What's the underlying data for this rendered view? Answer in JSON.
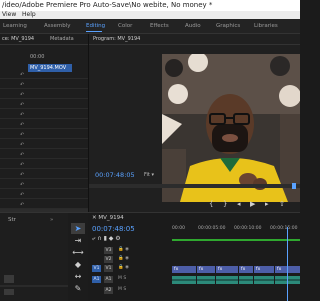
{
  "title": "/ideo/Adobe Premiere Pro Auto-Save\\No webite, No money *",
  "menu": [
    "View",
    "Help"
  ],
  "workspaces": [
    "Learning",
    "Assembly",
    "Editing",
    "Color",
    "Effects",
    "Audio",
    "Graphics",
    "Libraries"
  ],
  "active_workspace": "Editing",
  "source_panel": {
    "tabs": [
      "ce: MV_9194",
      "Metadata"
    ],
    "clip_selected": "MV_9194.MOV",
    "timecode": "00:00"
  },
  "program": {
    "title": "Program: MV_9194",
    "timecode": "00:07:48:05",
    "fit": "Fit"
  },
  "project_panel": {
    "label": "Str"
  },
  "timeline": {
    "sequence": "MV_9194",
    "timecode": "00:07:48:05",
    "ruler": [
      "00:00",
      "00:00:05:00",
      "00:00:10:00",
      "00:00:15:00"
    ],
    "video_tracks": [
      "V3",
      "V2",
      "V1"
    ],
    "audio_tracks": [
      "A1",
      "A2"
    ],
    "clip_label": "fx"
  },
  "colors": {
    "accent": "#5aa2ff",
    "video_clip": "#4d5ea8",
    "audio_clip": "#2c8a7a"
  }
}
